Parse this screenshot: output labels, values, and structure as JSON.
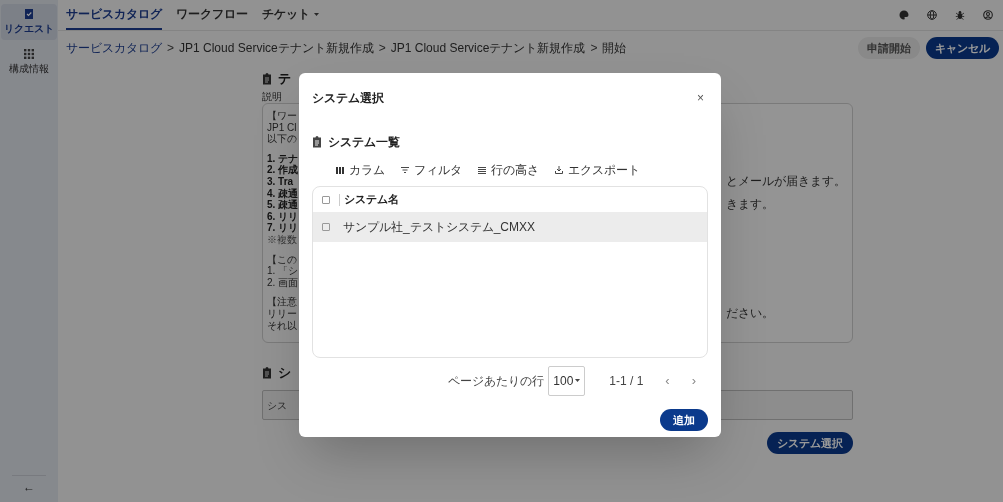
{
  "sidebar": {
    "items": [
      {
        "label": "リクエスト",
        "kind": "request",
        "selected": true
      },
      {
        "label": "構成情報",
        "kind": "grid",
        "selected": false
      }
    ],
    "back": "←"
  },
  "nav": {
    "tabs": [
      {
        "label": "サービスカタログ",
        "selected": true,
        "dropdown": false
      },
      {
        "label": "ワークフロー",
        "selected": false,
        "dropdown": false
      },
      {
        "label": "チケット",
        "selected": false,
        "dropdown": true
      }
    ]
  },
  "breadcrumb": {
    "separator": ">",
    "items": [
      "サービスカタログ",
      "JP1 Cloud Serviceテナント新規作成",
      "JP1 Cloud Serviceテナント新規作成",
      "開始"
    ]
  },
  "actions": [
    {
      "label": "申請開始",
      "disabled": true
    },
    {
      "label": "キャンセル",
      "disabled": false
    }
  ],
  "background": {
    "section_title": "テ",
    "description_label": "説明",
    "lines": [
      {
        "left": "【ワー",
        "kind": "normal"
      },
      {
        "left": "JP1 Cl",
        "kind": "normal"
      },
      {
        "left": "以下の",
        "kind": "normal"
      },
      {
        "kind": "blank"
      },
      {
        "left": "1. テナ",
        "kind": "bold"
      },
      {
        "left": "2. 作成",
        "kind": "bold"
      },
      {
        "left": "3. Tra",
        "right": "とメールが届きます。",
        "kind": "bold"
      },
      {
        "left": "4. 疎通",
        "kind": "bold"
      },
      {
        "left": "5. 疎通",
        "right": "きます。",
        "kind": "bold"
      },
      {
        "left": "6. リリ",
        "kind": "bold"
      },
      {
        "left": "7. リリ",
        "kind": "bold"
      },
      {
        "left": "※複数",
        "kind": "note"
      },
      {
        "kind": "blank"
      },
      {
        "left": "【この",
        "kind": "normal"
      },
      {
        "left": "1. 「シ",
        "kind": "normal"
      },
      {
        "left": "2. 画面",
        "kind": "normal"
      },
      {
        "kind": "blank"
      },
      {
        "left": "【注意",
        "kind": "normal"
      },
      {
        "left": "リリー",
        "right": "ださい。",
        "kind": "normal"
      },
      {
        "left": "それ以",
        "kind": "normal"
      }
    ],
    "system_title": "シ",
    "system_field_placeholder": "シス",
    "select_button": "システム選択"
  },
  "dialog": {
    "title": "システム選択",
    "close": "×",
    "list_title": "システム一覧",
    "toolbar": [
      {
        "label": "カラム",
        "kind": "columns"
      },
      {
        "label": "フィルタ",
        "kind": "filter"
      },
      {
        "label": "行の高さ",
        "kind": "density"
      },
      {
        "label": "エクスポート",
        "kind": "export"
      }
    ],
    "table": {
      "columns": [
        "システム名"
      ],
      "header_checked": false,
      "rows": [
        {
          "name": "サンプル社_テストシステム_CMXX",
          "checked": false,
          "hovered": true
        }
      ]
    },
    "pagination": {
      "rows_label": "ページあたりの行",
      "rows_per_page": "100",
      "range": "1-1 / 1",
      "prev": "‹",
      "next": "›",
      "prev_disabled": true,
      "next_disabled": true
    },
    "add_button": "追加"
  }
}
